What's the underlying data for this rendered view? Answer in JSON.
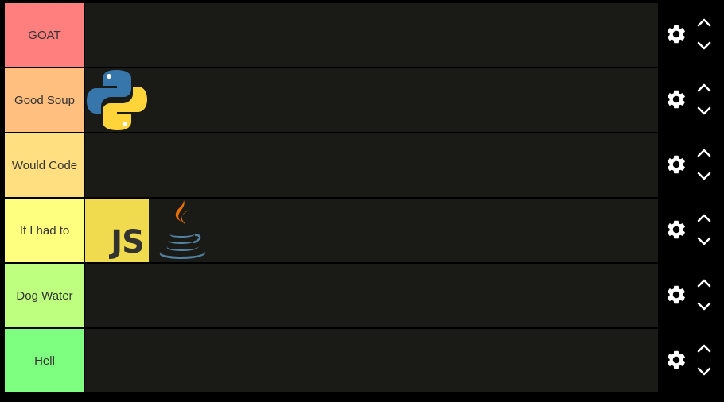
{
  "tiers": [
    {
      "label": "GOAT",
      "color": "#ff7f7f",
      "items": []
    },
    {
      "label": "Good Soup",
      "color": "#ffbf7f",
      "items": [
        "python-logo"
      ]
    },
    {
      "label": "Would Code",
      "color": "#ffdf7f",
      "items": []
    },
    {
      "label": "If I had to",
      "color": "#ffff7f",
      "items": [
        "javascript-logo",
        "java-logo"
      ]
    },
    {
      "label": "Dog Water",
      "color": "#bfff7f",
      "items": []
    },
    {
      "label": "Hell",
      "color": "#7fff7f",
      "items": []
    }
  ],
  "logos": {
    "javascript_text": "JS"
  },
  "icons": {
    "settings": "gear-icon",
    "move_up": "chevron-up-icon",
    "move_down": "chevron-down-icon"
  }
}
